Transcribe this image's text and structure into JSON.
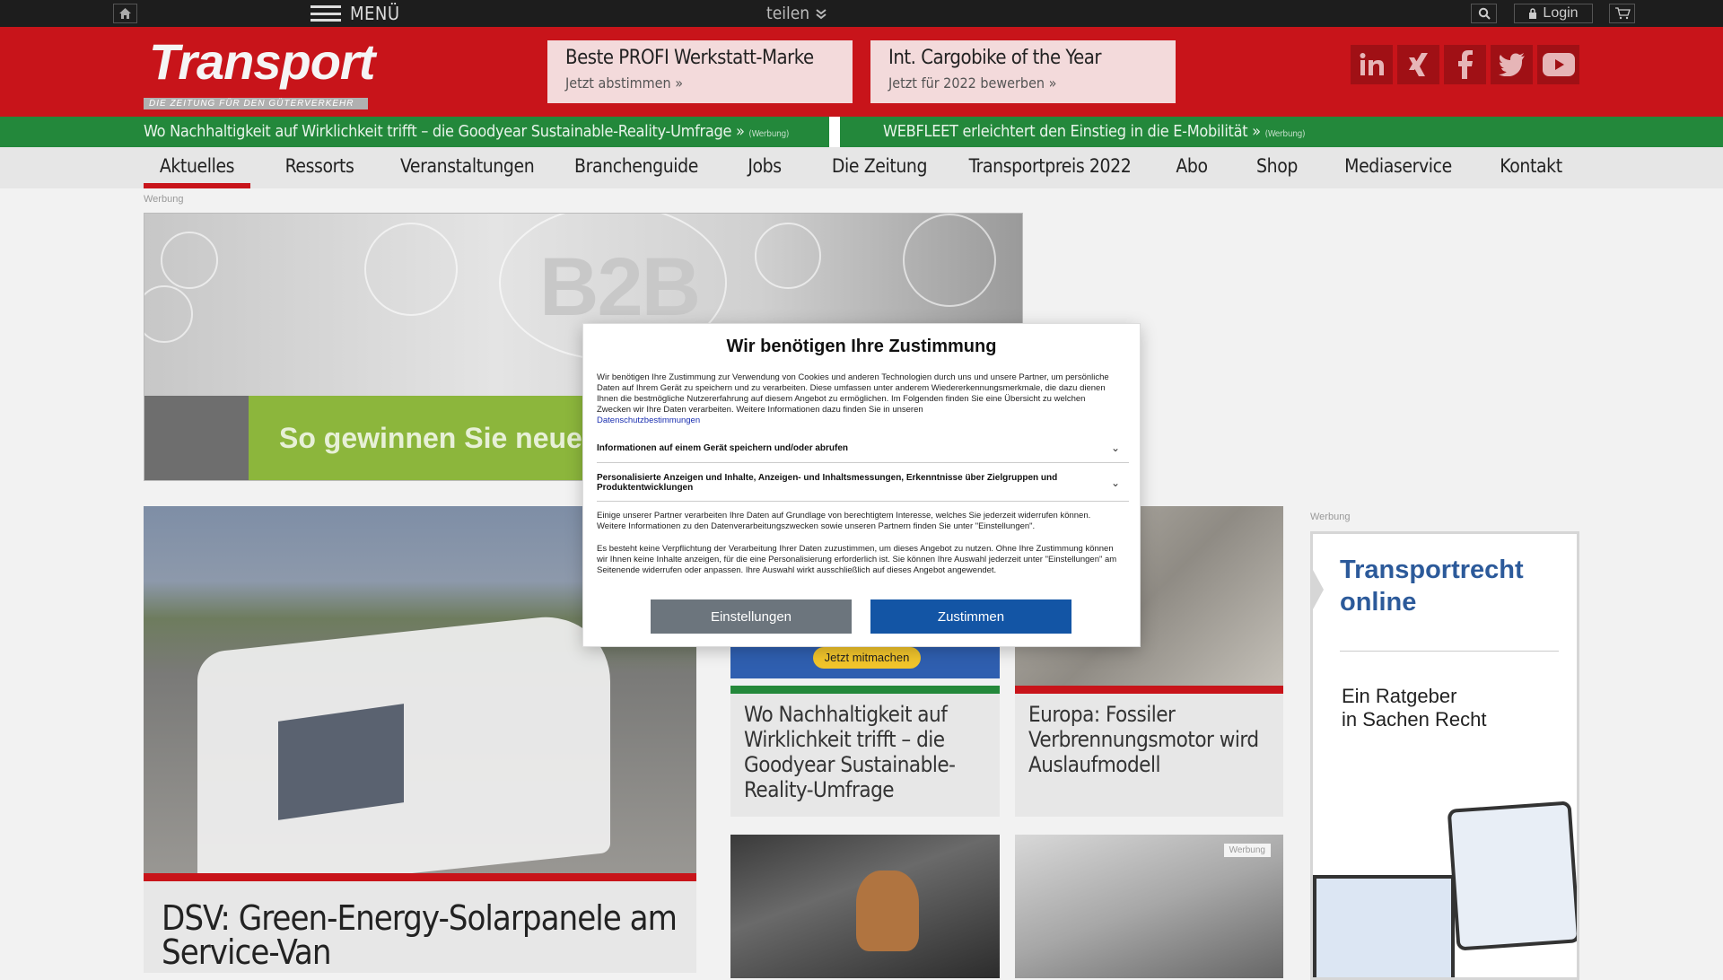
{
  "topbar": {
    "menu_label": "MENÜ",
    "share_label": "teilen",
    "login_label": "Login"
  },
  "header": {
    "logo_word": "Transport",
    "logo_tagline": "DIE ZEITUNG FÜR DEN GÜTERVERKEHR",
    "promos": [
      {
        "title": "Beste PROFI Werkstatt-Marke",
        "sub": "Jetzt abstimmen »"
      },
      {
        "title": "Int. Cargobike of the Year",
        "sub": "Jetzt für 2022 bewerben »"
      }
    ],
    "social": [
      "linkedin-icon",
      "xing-icon",
      "facebook-icon",
      "twitter-icon",
      "youtube-icon"
    ]
  },
  "adstrip": {
    "left": "Wo Nachhaltigkeit auf Wirklichkeit trifft – die Goodyear Sustainable-Reality-Umfrage »",
    "right": "WEBFLEET erleichtert den Einstieg in die E-Mobilität »",
    "tag": "(Werbung)"
  },
  "nav": {
    "items": [
      "Aktuelles",
      "Ressorts",
      "Veranstaltungen",
      "Branchenguide",
      "Jobs",
      "Die Zeitung",
      "Transportpreis 2022",
      "Abo",
      "Shop",
      "Mediaservice",
      "Kontakt"
    ],
    "active": "Aktuelles"
  },
  "ads": {
    "label": "Werbung",
    "b2b_big": "B2B",
    "b2b_slogan": "So gewinnen Sie neue",
    "cta_mitmachen": "Jetzt mitmachen",
    "side_title_line1": "Transportrecht",
    "side_title_line2": "online",
    "side_sub_line1": "Ein Ratgeber",
    "side_sub_line2": "in Sachen Recht"
  },
  "stories": {
    "main": "DSV: Green-Energy-Solarpanele am Service-Van",
    "card1": "Wo Nachhaltigkeit auf Wirklichkeit trifft – die Goodyear Sustainable-Reality-Umfrage",
    "card2": "Europa: Fossiler Verbrennungsmotor wird Auslaufmodell",
    "card4_tag": "Werbung"
  },
  "consent": {
    "title": "Wir benötigen Ihre Zustimmung",
    "intro": "Wir benötigen Ihre Zustimmung zur Verwendung von Cookies und anderen Technologien durch uns und unsere Partner, um persönliche Daten auf Ihrem Gerät zu speichern und zu verarbeiten. Diese umfassen unter anderem Wiedererkennungsmerkmale, die dazu dienen Ihnen die bestmögliche Nutzererfahrung auf diesem Angebot zu ermöglichen. Im Folgenden finden Sie eine Übersicht zu welchen Zwecken wir Ihre Daten verarbeiten. Weitere Informationen dazu finden Sie in unseren",
    "privacy_link": "Datenschutzbestimmungen",
    "purpose1": "Informationen auf einem Gerät speichern und/oder abrufen",
    "purpose2": "Personalisierte Anzeigen und Inhalte, Anzeigen- und Inhaltsmessungen, Erkenntnisse über Zielgruppen und Produktentwicklungen",
    "legit": "Einige unserer Partner verarbeiten Ihre Daten auf Grundlage von berechtigtem Interesse, welches Sie jederzeit widerrufen können. Weitere Informationen zu den Datenverarbeitungszwecken sowie unseren Partnern finden Sie unter \"Einstellungen\".",
    "no_obligation": "Es besteht keine Verpflichtung der Verarbeitung Ihrer Daten zuzustimmen, um dieses Angebot zu nutzen. Ohne Ihre Zustimmung können wir Ihnen keine Inhalte anzeigen, für die eine Personalisierung erforderlich ist. Sie können Ihre Auswahl jederzeit unter \"Einstellungen\" am Seitenende widerrufen oder anpassen. Ihre Auswahl wirkt ausschließlich auf dieses Angebot angewendet.",
    "settings_label": "Einstellungen",
    "accept_label": "Zustimmen"
  },
  "colors": {
    "brand_red": "#c8141a",
    "ad_green": "#23883b",
    "accept_blue": "#1355a5"
  }
}
